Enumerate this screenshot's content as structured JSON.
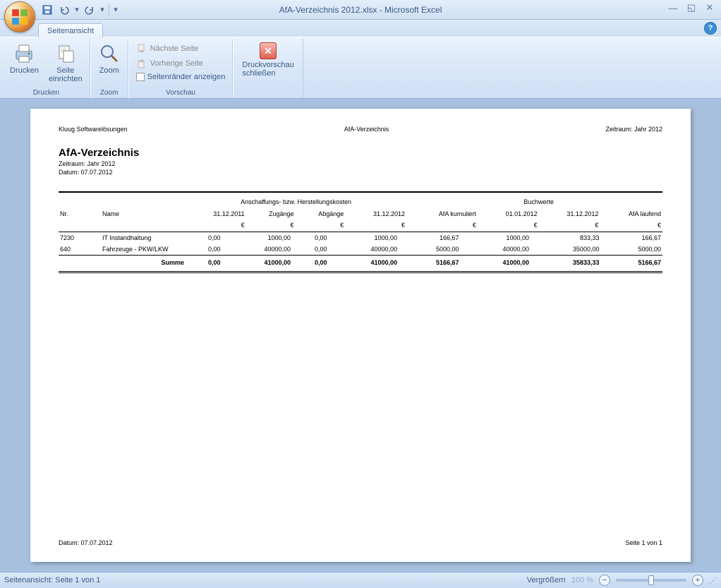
{
  "window": {
    "title": "AfA-Verzeichnis 2012.xlsx - Microsoft Excel"
  },
  "tab": {
    "label": "Seitenansicht"
  },
  "ribbon": {
    "print_group": "Drucken",
    "print": "Drucken",
    "page_setup_l1": "Seite",
    "page_setup_l2": "einrichten",
    "zoom_group": "Zoom",
    "zoom": "Zoom",
    "preview_group": "Vorschau",
    "next_page": "Nächste Seite",
    "prev_page": "Vorherige Seite",
    "show_margins": "Seitenränder anzeigen",
    "close_l1": "Druckvorschau",
    "close_l2": "schließen"
  },
  "page": {
    "hdr_left": "Kluug Softwarelösungen",
    "hdr_center": "AfA-Verzeichnis",
    "hdr_right": "Zeitraum: Jahr 2012",
    "title": "AfA-Verzeichnis",
    "sub1": "Zeitraum: Jahr 2012",
    "sub2": "Datum: 07.07.2012",
    "grp1": "Anschaffungs- bzw. Herstellungskosten",
    "grp2": "Buchwerte",
    "col_nr": "Nr.",
    "col_name": "Name",
    "col_start": "31.12.2011",
    "col_zug": "Zugänge",
    "col_abg": "Abgänge",
    "col_end": "31.12.2012",
    "col_afakum": "AfA kumuliert",
    "col_bw_start": "01.01.2012",
    "col_bw_end": "31.12.2012",
    "col_afalauf": "AfA laufend",
    "euro": "€",
    "rows": [
      {
        "nr": "7230",
        "name": "IT Instandhaltung",
        "c1": "0,00",
        "c2": "1000,00",
        "c3": "0,00",
        "c4": "1000,00",
        "c5": "166,67",
        "c6": "1000,00",
        "c7": "833,33",
        "c8": "166,67"
      },
      {
        "nr": "640",
        "name": "Fahrzeuge - PKW/LKW",
        "c1": "0,00",
        "c2": "40000,00",
        "c3": "0,00",
        "c4": "40000,00",
        "c5": "5000,00",
        "c6": "40000,00",
        "c7": "35000,00",
        "c8": "5000,00"
      }
    ],
    "sum_label": "Summe",
    "sum": {
      "c1": "0,00",
      "c2": "41000,00",
      "c3": "0,00",
      "c4": "41000,00",
      "c5": "5166,67",
      "c6": "41000,00",
      "c7": "35833,33",
      "c8": "5166,67"
    },
    "ftr_left": "Datum: 07.07.2012",
    "ftr_right": "Seite 1 von 1"
  },
  "status": {
    "left": "Seitenansicht: Seite 1 von 1",
    "hint": "Vergrößern",
    "zoom": "100 %"
  }
}
